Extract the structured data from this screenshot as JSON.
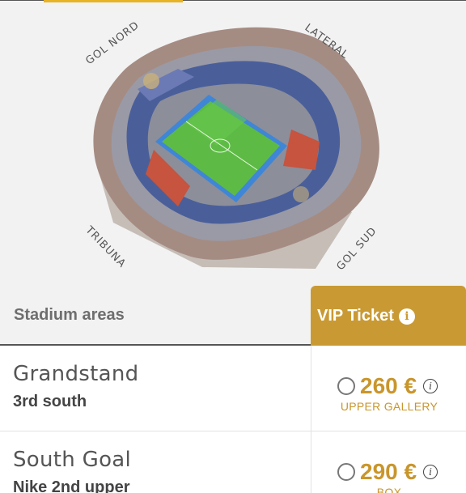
{
  "map": {
    "labels": {
      "north": "GOL NORD",
      "lateral": "LATERAL",
      "tribuna": "TRIBUNA",
      "south": "GOL SUD"
    }
  },
  "table": {
    "header": {
      "areas_label": "Stadium areas",
      "ticket_type": "VIP Ticket",
      "info_glyph": "i"
    },
    "rows": [
      {
        "area": "Grandstand",
        "sub": "3rd south",
        "price": "260 €",
        "category": "UPPER GALLERY",
        "info_glyph": "i"
      },
      {
        "area": "South Goal",
        "sub": "Nike 2nd upper",
        "price": "290 €",
        "category": "BOX",
        "info_glyph": "i"
      }
    ]
  },
  "colors": {
    "accent": "#c99a34",
    "price": "#c9962c",
    "tab_indicator": "#e8b325"
  }
}
